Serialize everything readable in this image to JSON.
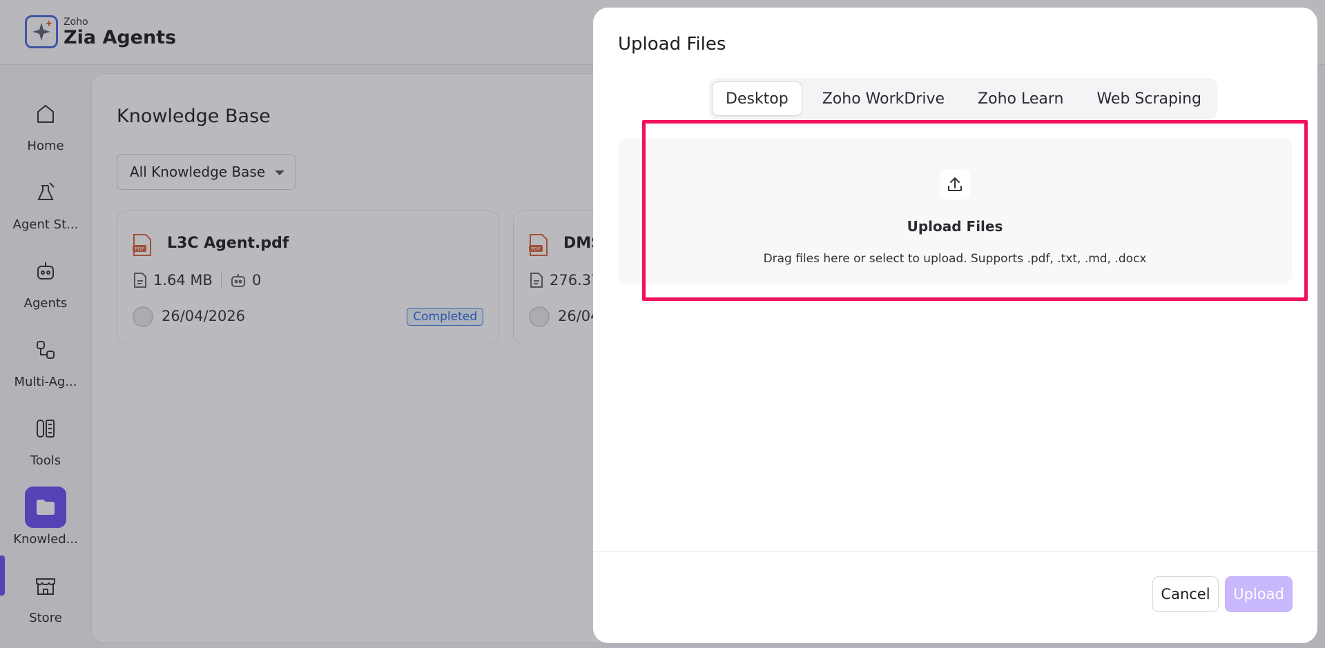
{
  "app": {
    "brand_small": "Zoho",
    "brand_name": "Zia Agents"
  },
  "sidebar": {
    "items": [
      {
        "label": "Home",
        "icon": "home-icon"
      },
      {
        "label": "Agent St...",
        "icon": "agent-studio-icon"
      },
      {
        "label": "Agents",
        "icon": "robot-icon"
      },
      {
        "label": "Multi-Ag...",
        "icon": "workflow-icon"
      },
      {
        "label": "Tools",
        "icon": "tools-icon"
      },
      {
        "label": "Knowled...",
        "icon": "folder-icon",
        "active": true
      },
      {
        "label": "Store",
        "icon": "store-icon"
      }
    ]
  },
  "main": {
    "title": "Knowledge Base",
    "filter": "All Knowledge Base",
    "cards": [
      {
        "name": "L3C Agent.pdf",
        "size": "1.64 MB",
        "agents": "0",
        "date": "26/04/2026",
        "status": "Completed"
      },
      {
        "name": "DMS",
        "size": "276.37",
        "date": "26/04"
      }
    ]
  },
  "modal": {
    "title": "Upload Files",
    "tabs": [
      "Desktop",
      "Zoho WorkDrive",
      "Zoho Learn",
      "Web Scraping"
    ],
    "active_tab": "Desktop",
    "dropzone": {
      "title": "Upload Files",
      "subtitle": "Drag files here or select to upload. Supports .pdf, .txt, .md, .docx"
    },
    "cancel_label": "Cancel",
    "upload_label": "Upload"
  },
  "colors": {
    "accent": "#6a4ef2",
    "highlight": "#f0115a",
    "upload_disabled": "#c9b8fb",
    "status_blue": "#2d6ad6"
  }
}
